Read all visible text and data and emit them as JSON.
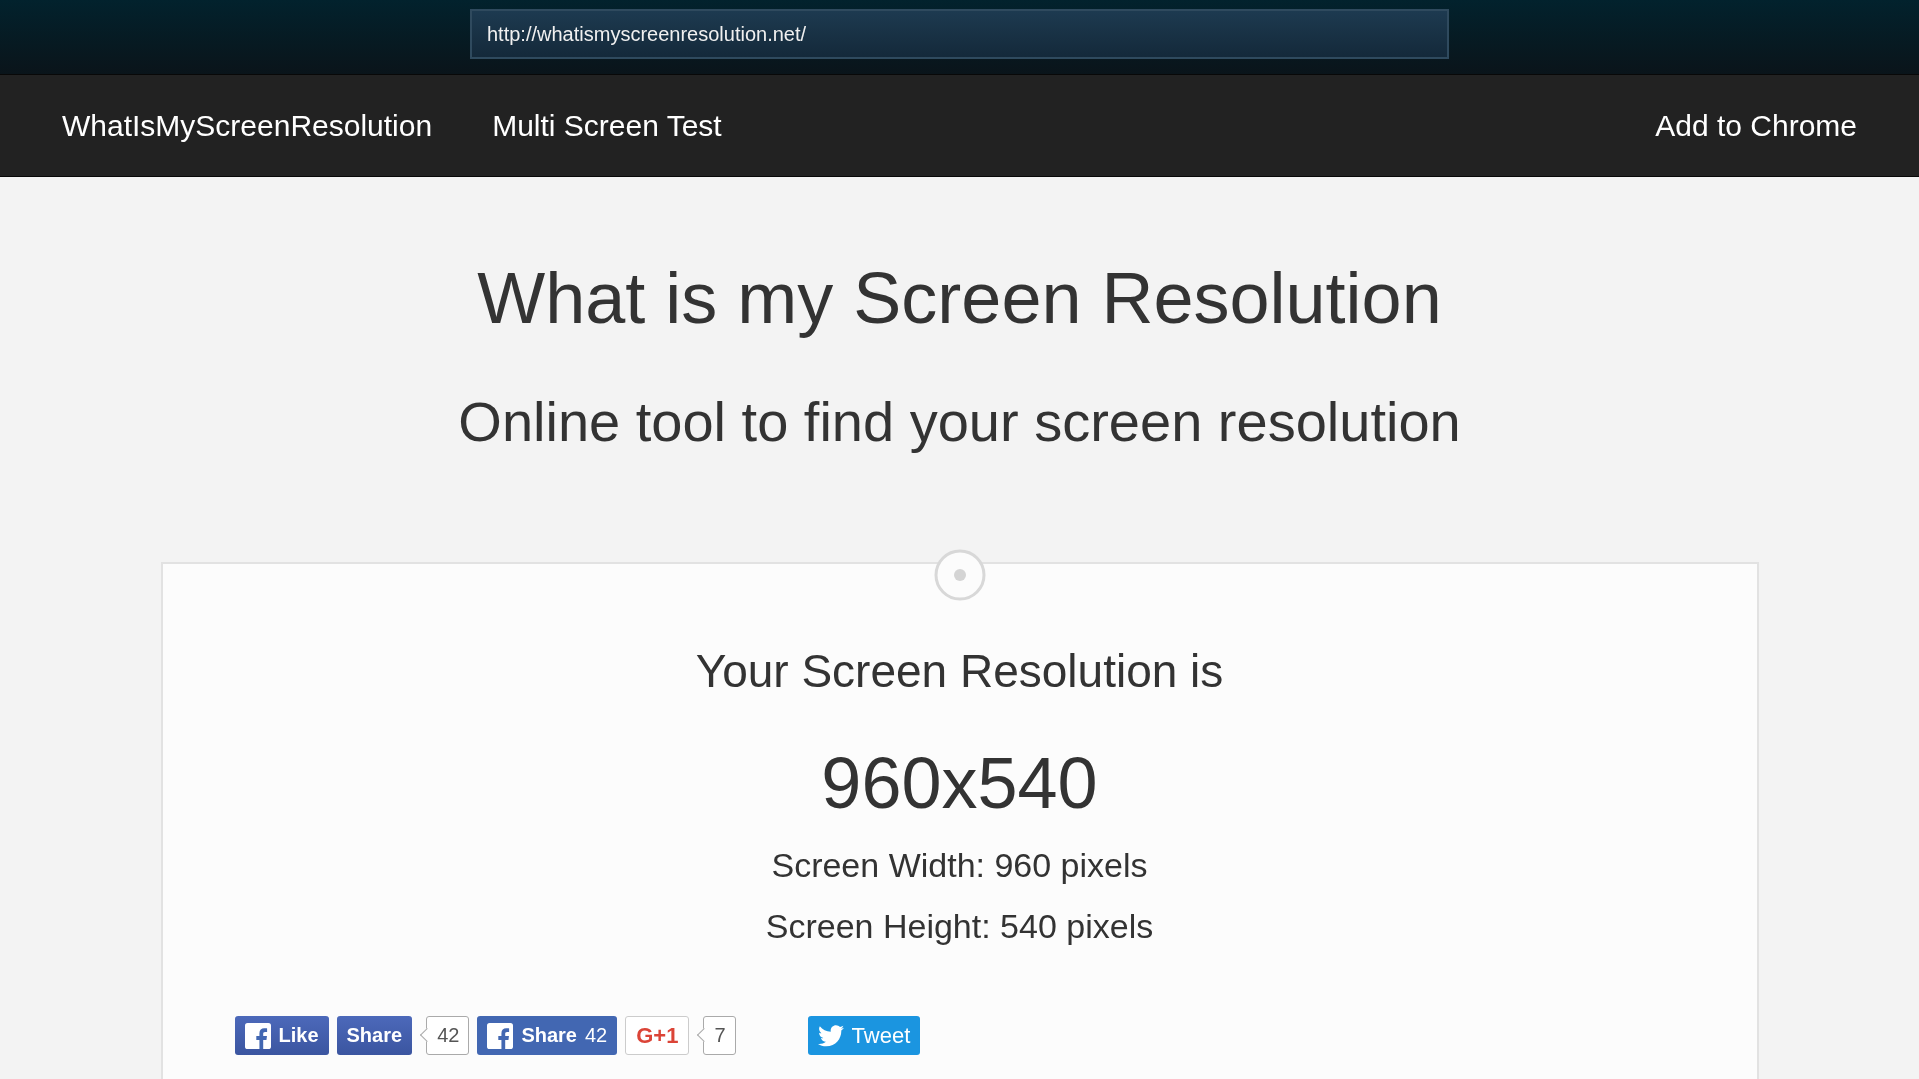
{
  "browser": {
    "url": "http://whatismyscreenresolution.net/"
  },
  "nav": {
    "brand": "WhatIsMyScreenResolution",
    "links": [
      "Multi Screen Test"
    ],
    "right_link": "Add to Chrome"
  },
  "headline": "What is my Screen Resolution",
  "subheadline": "Online tool to find your screen resolution",
  "card": {
    "heading": "Your Screen Resolution is",
    "resolution": "960x540",
    "lines": [
      "Screen Width: 960 pixels",
      "Screen Height: 540 pixels"
    ]
  },
  "social": [
    {
      "kind": "fb_like",
      "label": "Like"
    },
    {
      "kind": "fb_share",
      "label": "Share",
      "count": "42"
    },
    {
      "kind": "fb_share_inline",
      "label": "Share",
      "count": "42"
    },
    {
      "kind": "gplus",
      "label": "G+1",
      "count": "7"
    },
    {
      "kind": "tweet",
      "label": "Tweet"
    }
  ]
}
